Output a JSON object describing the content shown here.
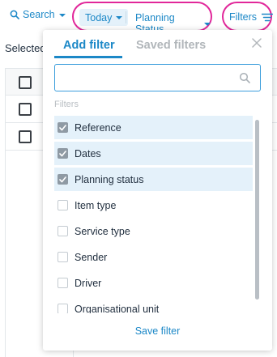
{
  "toolbar": {
    "search_label": "Search",
    "today_label": "Today",
    "planning_status_label": "Planning Status",
    "filters_label": "Filters"
  },
  "background": {
    "selected_label": "Selected"
  },
  "filter_panel": {
    "tabs": [
      {
        "label": "Add filter",
        "active": true
      },
      {
        "label": "Saved filters",
        "active": false
      }
    ],
    "search": {
      "value": "",
      "placeholder": ""
    },
    "section_label": "Filters",
    "items": [
      {
        "label": "Reference",
        "checked": true
      },
      {
        "label": "Dates",
        "checked": true
      },
      {
        "label": "Planning status",
        "checked": true
      },
      {
        "label": "Item type",
        "checked": false
      },
      {
        "label": "Service type",
        "checked": false
      },
      {
        "label": "Sender",
        "checked": false
      },
      {
        "label": "Driver",
        "checked": false
      },
      {
        "label": "Organisational unit",
        "checked": false
      }
    ],
    "save_label": "Save filter"
  },
  "colors": {
    "accent": "#1c88c7",
    "highlight_outline": "#e1279a",
    "checked_row_bg": "#e4f1fa"
  }
}
